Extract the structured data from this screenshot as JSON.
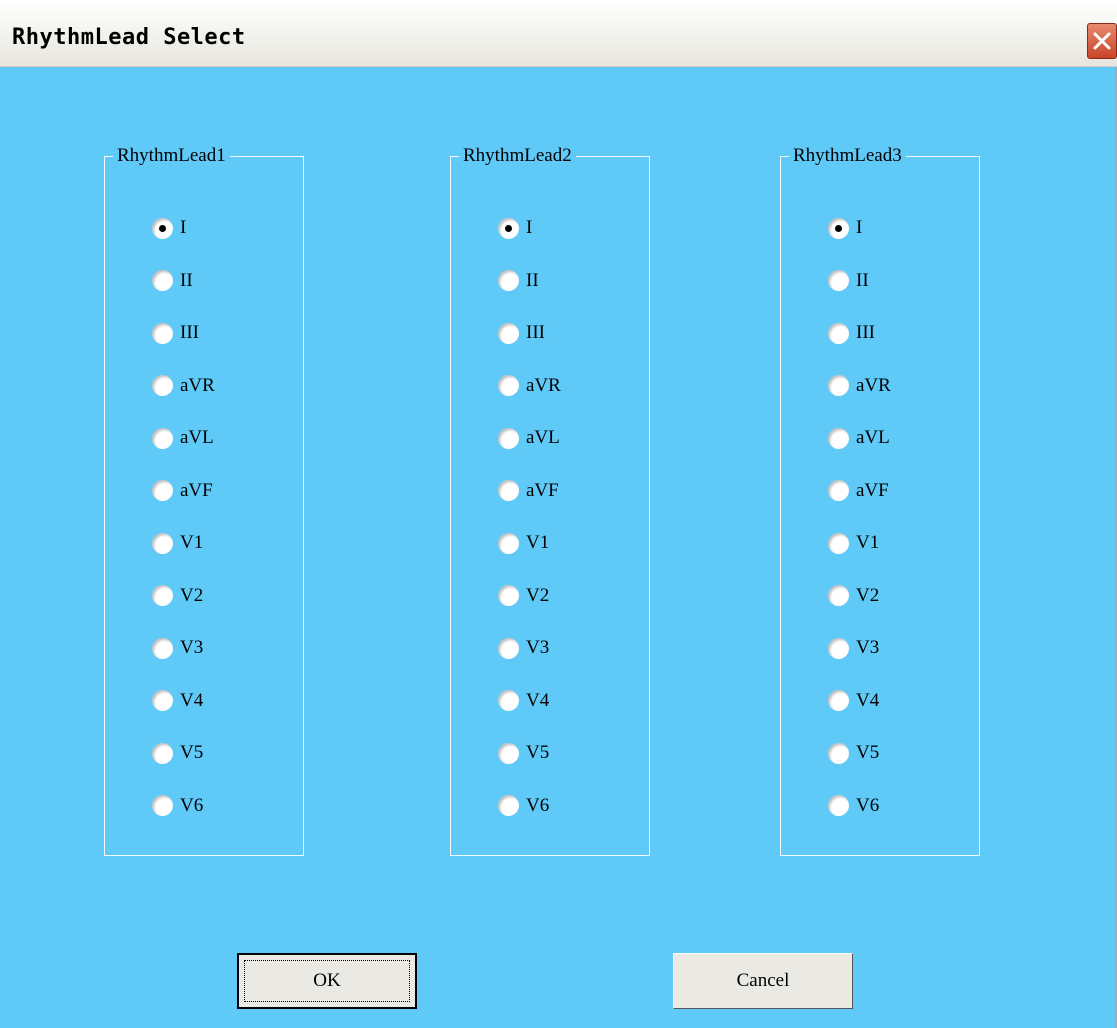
{
  "window": {
    "title": "RhythmLead Select"
  },
  "groups": [
    {
      "title": "RhythmLead1",
      "selected": "I",
      "options": [
        "I",
        "II",
        "III",
        "aVR",
        "aVL",
        "aVF",
        "V1",
        "V2",
        "V3",
        "V4",
        "V5",
        "V6"
      ]
    },
    {
      "title": "RhythmLead2",
      "selected": "I",
      "options": [
        "I",
        "II",
        "III",
        "aVR",
        "aVL",
        "aVF",
        "V1",
        "V2",
        "V3",
        "V4",
        "V5",
        "V6"
      ]
    },
    {
      "title": "RhythmLead3",
      "selected": "I",
      "options": [
        "I",
        "II",
        "III",
        "aVR",
        "aVL",
        "aVF",
        "V1",
        "V2",
        "V3",
        "V4",
        "V5",
        "V6"
      ]
    }
  ],
  "buttons": {
    "ok": "OK",
    "cancel": "Cancel"
  },
  "colors": {
    "client_background": "#5fcaf8",
    "close_button": "#d2563a"
  },
  "icons": {
    "close": "close-icon"
  }
}
